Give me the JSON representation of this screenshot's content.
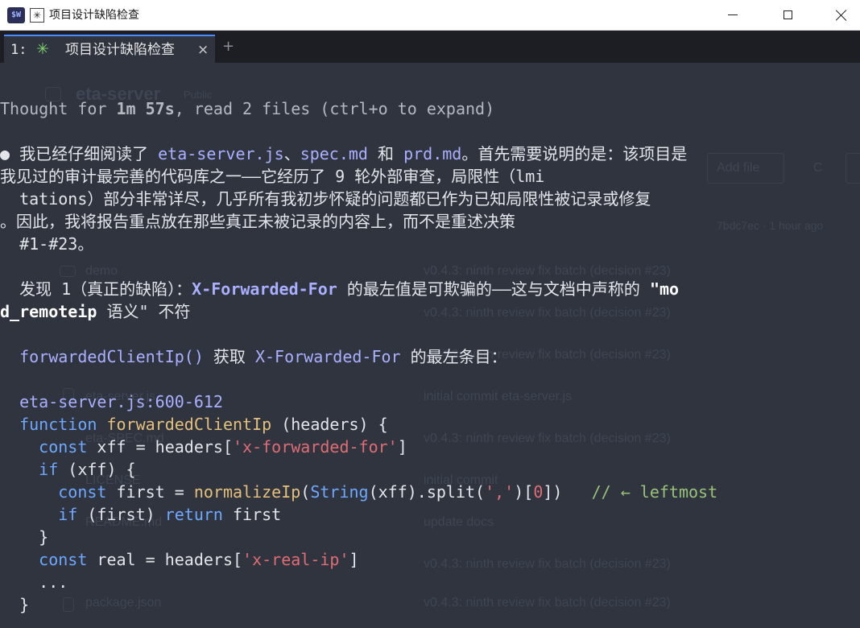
{
  "window": {
    "app_icon_text": "$W",
    "title_icon": "✳",
    "title": "项目设计缺陷检查"
  },
  "tabs": [
    {
      "index": "1:",
      "icon": "✳",
      "label": "项目设计缺陷检查",
      "close": "×"
    }
  ],
  "new_tab": "+",
  "background": {
    "repo_name": "eta-server",
    "visibility": "Public",
    "add_file": "Add file",
    "code": "C",
    "commit_hash": "7bdc7ec · 1 hour ago",
    "files": [
      {
        "name": "demo",
        "message": "v0.4.3: ninth review fix batch (decision #23)"
      },
      {
        "name": "",
        "message": "v0.4.3: ninth review fix batch (decision #23)"
      },
      {
        "name": "",
        "message": "v0.4.3: ninth review fix batch (decision #23)"
      },
      {
        "name": "eta-server.js",
        "message": "initial commit eta-server.js"
      },
      {
        "name": "eta-SPEC.md",
        "message": "v0.4.3: ninth review fix batch (decision #23)"
      },
      {
        "name": "LICENSE",
        "message": "initial commit"
      },
      {
        "name": "README.md",
        "message": "update docs"
      },
      {
        "name": "",
        "message": "v0.4.3: ninth review fix batch (decision #23)"
      },
      {
        "name": "package.json",
        "message": "v0.4.3: ninth review fix batch (decision #23)"
      }
    ]
  },
  "terminal": {
    "thought": {
      "prefix": "Thought for ",
      "duration": "1m 57s",
      "suffix": ", read 2 files (ctrl+o to expand)"
    },
    "para1": {
      "bullet": "●",
      "l1_a": " 我已经仔细阅读了 ",
      "l1_f1": "eta-server.js",
      "l1_b": "、",
      "l1_f2": "spec.md",
      "l1_c": " 和 ",
      "l1_f3": "prd.md",
      "l1_d": "。首先需要说明的是：该项目是",
      "l2": "我见过的审计最完善的代码库之一——它经历了 9 轮外部审查，局限性（lmi",
      "l3": "  tations）部分非常详尽，几乎所有我初步怀疑的问题都已作为已知局限性被记录或修复",
      "l4": "。因此，我将报告重点放在那些真正未被记录的内容上，而不是重述决策",
      "l5": "  #1-#23。"
    },
    "finding1": {
      "l1_a": "  发现 1（真正的缺陷）：",
      "l1_code": "X-Forwarded-For",
      "l1_b": " 的最左值是可欺骗的——这与文档中声称的 ",
      "l1_bold": "\"mo",
      "l2_bold": "d_remoteip",
      "l2_b": " 语义\" 不符"
    },
    "finding_desc": {
      "code1": "forwardedClientIp()",
      "mid": " 获取 ",
      "code2": "X-Forwarded-For",
      "tail": " 的最左条目："
    },
    "code_ref": "eta-server.js:600-612",
    "code": {
      "kw_function": "function",
      "fn_name": "forwardedClientIp",
      "params": " (headers) {",
      "kw_const": "const",
      "xff_decl": " xff = headers[",
      "str_xff": "'x-forwarded-for'",
      "close_bracket": "]",
      "kw_if": "if",
      "if_xff": " (xff) {",
      "first_decl": " first = ",
      "fn_normalize": "normalizeIp",
      "paren_open": "(",
      "kw_string": "String",
      "split_call": "(xff).split(",
      "str_comma": "','",
      "index_open": ")[",
      "num_zero": "0",
      "index_close": "])",
      "comment": "// ← leftmost",
      "if_first": " (first) ",
      "kw_return": "return",
      "return_val": " first",
      "brace_close": "}",
      "real_decl": " real = headers[",
      "str_real": "'x-real-ip'",
      "ellipsis": "..."
    }
  }
}
